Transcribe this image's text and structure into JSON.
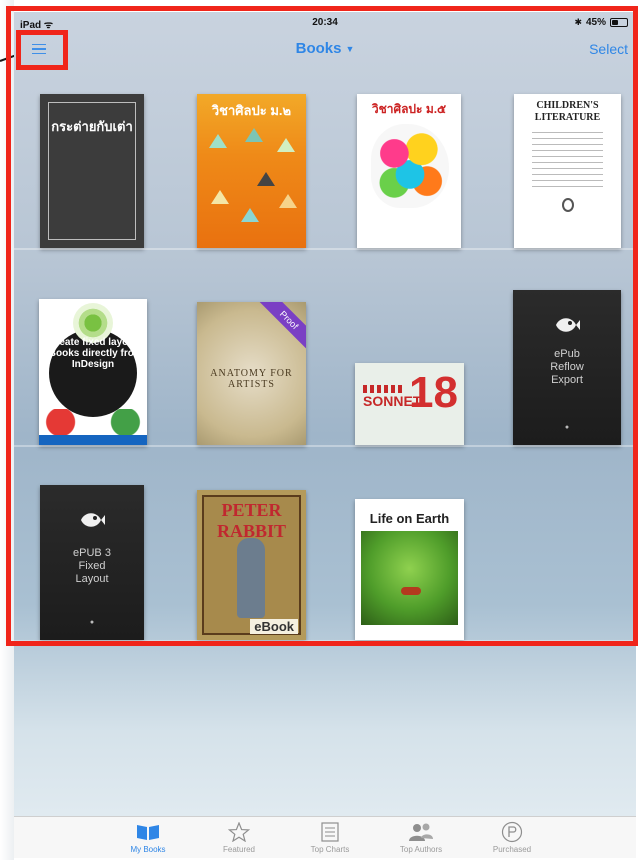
{
  "status_bar": {
    "device": "iPad",
    "wifi_icon": "wifi-icon",
    "time": "20:34",
    "battery": "45%",
    "battery_level": 0.45
  },
  "nav": {
    "menu_icon": "hamburger-menu-icon",
    "title": "Books",
    "title_caret": "▼",
    "select_label": "Select"
  },
  "books": [
    {
      "title": "กระต่ายกับเต่า"
    },
    {
      "title": "วิชาศิลปะ ม.๒"
    },
    {
      "title": "วิชาศิลปะ ม.๕"
    },
    {
      "title": "CHILDREN'S LITERATURE"
    },
    {
      "title": "Create fixed layout eBooks directly from InDesign"
    },
    {
      "title": "ANATOMY FOR ARTISTS",
      "badge": "Proof"
    },
    {
      "title": "SONNET",
      "number": "18"
    },
    {
      "title": "ePub Reflow Export"
    },
    {
      "title": "ePUB 3 Fixed Layout"
    },
    {
      "title": "PETER RABBIT",
      "badge": "eBook"
    },
    {
      "title": "Life on Earth"
    }
  ],
  "tabs": [
    {
      "label": "My Books",
      "icon": "open-book-icon",
      "active": true
    },
    {
      "label": "Featured",
      "icon": "star-icon",
      "active": false
    },
    {
      "label": "Top Charts",
      "icon": "list-icon",
      "active": false
    },
    {
      "label": "Top Authors",
      "icon": "people-icon",
      "active": false
    },
    {
      "label": "Purchased",
      "icon": "purchased-icon",
      "active": false
    }
  ],
  "colors": {
    "accent": "#2f86e6",
    "highlight": "#f0251a"
  }
}
